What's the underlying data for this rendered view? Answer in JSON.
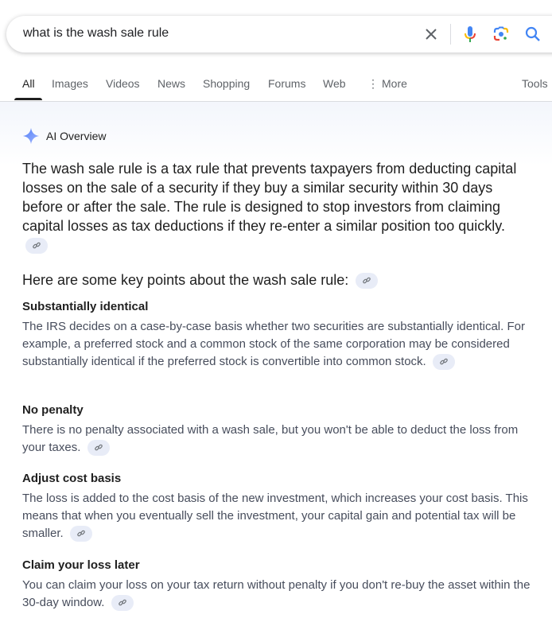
{
  "search": {
    "query": "what is the wash sale rule",
    "clear_icon": "close-icon",
    "mic_icon": "microphone-icon",
    "lens_icon": "google-lens-icon",
    "search_icon": "search-icon"
  },
  "tabs": [
    {
      "label": "All",
      "active": true
    },
    {
      "label": "Images"
    },
    {
      "label": "Videos"
    },
    {
      "label": "News"
    },
    {
      "label": "Shopping"
    },
    {
      "label": "Forums"
    },
    {
      "label": "Web"
    },
    {
      "label": "More",
      "icon": "more-vertical-icon"
    }
  ],
  "tools_label": "Tools",
  "ai_overview": {
    "title": "AI Overview",
    "summary": "The wash sale rule is a tax rule that prevents taxpayers from deducting capital losses on the sale of a security if they buy a similar security within 30 days before or after the sale. The rule is designed to stop investors from claiming capital losses as tax deductions if they re-enter a similar position too quickly.",
    "key_points_heading": "Here are some key points about the wash sale rule:",
    "points": [
      {
        "title": "Substantially identical",
        "body": "The IRS decides on a case-by-case basis whether two securities are substantially identical. For example, a preferred stock and a common stock of the same corporation may be considered substantially identical if the preferred stock is convertible into common stock."
      },
      {
        "title": "No penalty",
        "body": "There is no penalty associated with a wash sale, but you won't be able to deduct the loss from your taxes."
      },
      {
        "title": "Adjust cost basis",
        "body": "The loss is added to the cost basis of the new investment, which increases your cost basis. This means that when you eventually sell the investment, your capital gain and potential tax will be smaller."
      },
      {
        "title": "Claim your loss later",
        "body": "You can claim your loss on your tax return without penalty if you don't re-buy the asset within the 30-day window."
      }
    ]
  },
  "colors": {
    "accent_blue": "#4285f4",
    "active_tab": "#1f1f1f",
    "link_chip_bg": "#e8ecf7"
  }
}
